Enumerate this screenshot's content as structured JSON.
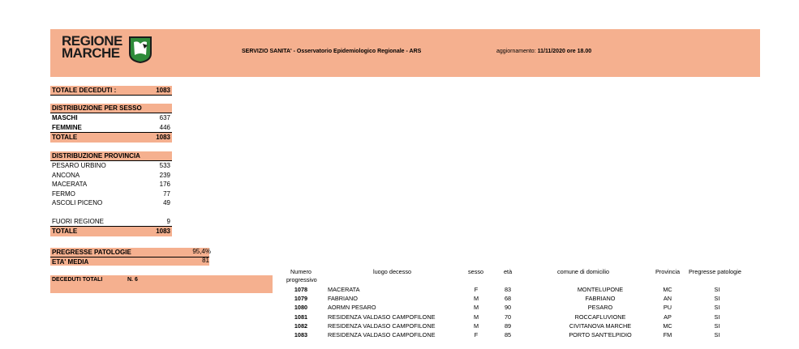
{
  "header": {
    "logo_text_line1": "REGIONE",
    "logo_text_line2": "MARCHE",
    "title": "SERVIZIO SANITA' - Osservatorio Epidemiologico Regionale - ARS",
    "update_label": "aggiornamento: ",
    "update_value": "11/11/2020  ore 18.00"
  },
  "totale_deceduti": {
    "label": "TOTALE DECEDUTI :",
    "value": "1083"
  },
  "per_sesso": {
    "title": "DISTRIBUZIONE PER SESSO",
    "rows": [
      {
        "label": "MASCHI",
        "value": "637"
      },
      {
        "label": "FEMMINE",
        "value": "446"
      }
    ],
    "total": {
      "label": "TOTALE",
      "value": "1083"
    }
  },
  "per_provincia": {
    "title": "DISTRIBUZIONE  PROVINCIA",
    "rows": [
      {
        "label": "PESARO URBINO",
        "value": "533"
      },
      {
        "label": "ANCONA",
        "value": "239"
      },
      {
        "label": "MACERATA",
        "value": "176"
      },
      {
        "label": "FERMO",
        "value": "77"
      },
      {
        "label": "ASCOLI PICENO",
        "value": "49"
      }
    ],
    "fuori": {
      "label": "FUORI REGIONE",
      "value": "9"
    },
    "total": {
      "label": "TOTALE",
      "value": "1083"
    }
  },
  "patologie": {
    "label": "PREGRESSE PATOLOGIE",
    "value": "95,4%"
  },
  "eta_media": {
    "label": "ETA' MEDIA",
    "value": "81"
  },
  "deceduti_totali": {
    "label": "DECEDUTI TOTALI",
    "value": "N.  6"
  },
  "table": {
    "headers": {
      "numero_line1": "Numero",
      "numero_line2": "progressivo",
      "luogo": "luogo decesso",
      "sesso": "sesso",
      "eta": "età",
      "comune": "comune di domicilio",
      "provincia": "Provincia",
      "patologie": "Pregresse patologie"
    },
    "rows": [
      {
        "num": "1078",
        "luogo": "MACERATA",
        "sesso": "F",
        "eta": "83",
        "comune": "MONTELUPONE",
        "prov": "MC",
        "pat": "SI"
      },
      {
        "num": "1079",
        "luogo": "FABRIANO",
        "sesso": "M",
        "eta": "68",
        "comune": "FABRIANO",
        "prov": "AN",
        "pat": "SI"
      },
      {
        "num": "1080",
        "luogo": "AORMN PESARO",
        "sesso": "M",
        "eta": "90",
        "comune": "PESARO",
        "prov": "PU",
        "pat": "SI"
      },
      {
        "num": "1081",
        "luogo": "RESIDENZA VALDASO CAMPOFILONE",
        "sesso": "M",
        "eta": "70",
        "comune": "ROCCAFLUVIONE",
        "prov": "AP",
        "pat": "SI"
      },
      {
        "num": "1082",
        "luogo": "RESIDENZA VALDASO CAMPOFILONE",
        "sesso": "M",
        "eta": "89",
        "comune": "CIVITANOVA MARCHE",
        "prov": "MC",
        "pat": "SI"
      },
      {
        "num": "1083",
        "luogo": "RESIDENZA VALDASO CAMPOFILONE",
        "sesso": "F",
        "eta": "85",
        "comune": "PORTO SANT'ELPIDIO",
        "prov": "FM",
        "pat": "SI"
      }
    ]
  },
  "colors": {
    "accent": "#f5b08f",
    "logo_green": "#2e8b3a"
  }
}
